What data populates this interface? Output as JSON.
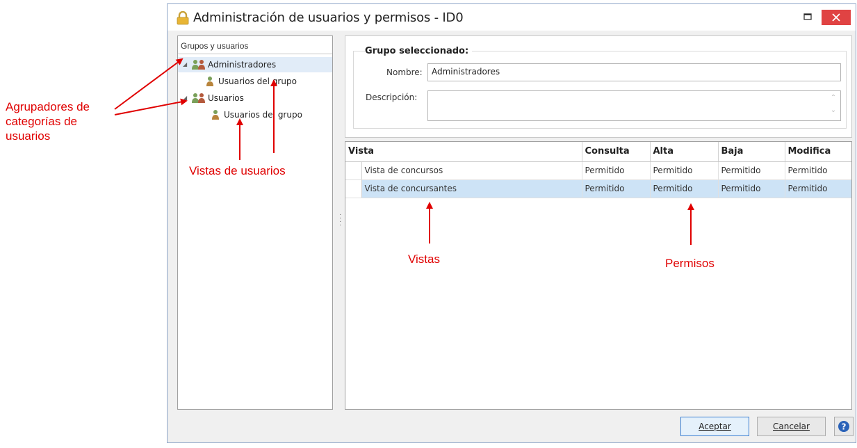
{
  "window": {
    "title": "Administración de usuarios y permisos - ID0"
  },
  "tree": {
    "header": "Grupos y usuarios",
    "items": [
      {
        "label": "Administradores"
      },
      {
        "label": "Usuarios del grupo"
      },
      {
        "label": "Usuarios"
      },
      {
        "label": "Usuarios del grupo"
      }
    ]
  },
  "group": {
    "legend": "Grupo seleccionado:",
    "name_label": "Nombre:",
    "name_value": "Administradores",
    "desc_label": "Descripción:",
    "desc_value": ""
  },
  "grid": {
    "columns": [
      "Vista",
      "Consulta",
      "Alta",
      "Baja",
      "Modifica"
    ],
    "rows": [
      [
        "Vista de concursos",
        "Permitido",
        "Permitido",
        "Permitido",
        "Permitido"
      ],
      [
        "Vista de concursantes",
        "Permitido",
        "Permitido",
        "Permitido",
        "Permitido"
      ]
    ]
  },
  "buttons": {
    "accept": "Aceptar",
    "cancel": "Cancelar"
  },
  "annotations": {
    "categories": "Agrupadores de categorías de usuarios",
    "user_views": "Vistas de usuarios",
    "views": "Vistas",
    "permissions": "Permisos"
  },
  "colors": {
    "annotation": "#e00000",
    "selection": "#cde3f6",
    "close_button": "#e04343"
  }
}
